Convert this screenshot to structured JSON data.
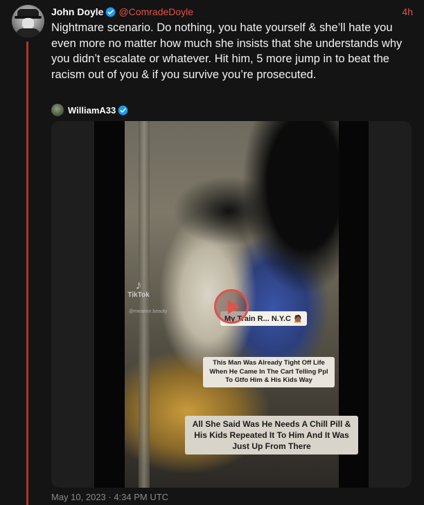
{
  "tweet": {
    "display_name": "John Doyle",
    "handle": "@ComradeDoyle",
    "time_ago": "4h",
    "text": "Nightmare scenario. Do nothing, you hate yourself & she’ll hate you even more no matter how much she insists that she understands why you didn’t escalate or whatever. Hit him, 5 more jump in to beat the racism out of you & if you survive you’re prosecuted.",
    "timestamp": "May 10, 2023 · 4:34 PM UTC"
  },
  "quoted": {
    "author": "WilliamA33"
  },
  "video": {
    "watermark_app": "TikTok",
    "watermark_user": "@meannn.beauty",
    "caption_top": "My Train R... N.Y.C 🙍🏾",
    "caption_middle": "This Man Was Already Tight Off Life When He Came In The Cart Telling Ppl To Gtfo Him & His Kids Way",
    "caption_bottom": "All She Said Was He Needs A Chill Pill & His Kids Repeated It To Him And It Was Just Up From There"
  },
  "colors": {
    "accent": "#e0524a",
    "thread_line": "#b0352e",
    "verified": "#1d9bf0",
    "background": "#141414"
  },
  "icons": [
    "verified-badge-icon",
    "play-icon",
    "tiktok-logo-icon"
  ]
}
